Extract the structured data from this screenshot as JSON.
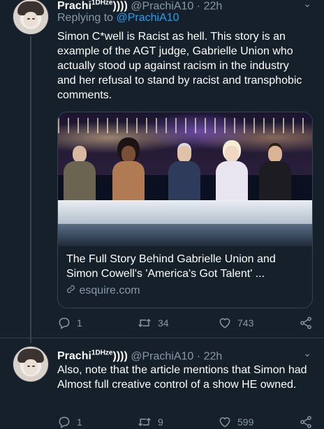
{
  "tweet1": {
    "name": "Prachi",
    "name_sup": "1DHze",
    "name_suffix": "))))",
    "handle": "@PrachiA10",
    "time": "22h",
    "replying_label": "Replying to",
    "replying_handle": "@PrachiA10",
    "text": "Simon C*well is Racist as hell. This story is an example of the AGT judge, Gabrielle Union who actually stood up against racism in the industry and her refusal to stand by racist and transphobic comments.",
    "card": {
      "title": "The Full Story Behind Gabrielle Union and Simon Cowell's 'America's Got Talent' ...",
      "domain": "esquire.com"
    },
    "actions": {
      "replies": "1",
      "retweets": "34",
      "likes": "743"
    }
  },
  "tweet2": {
    "name": "Prachi",
    "name_sup": "1DHze",
    "name_suffix": "))))",
    "handle": "@PrachiA10",
    "time": "22h",
    "text": "Also, note that the article mentions that Simon had Almost full creative control of a show HE owned.",
    "actions": {
      "replies": "1",
      "retweets": "9",
      "likes": "599"
    }
  },
  "colors": {
    "background": "#15202b",
    "secondary_text": "#8899a6",
    "link": "#1da1f2",
    "border": "#38444d"
  },
  "icons": [
    "reply-icon",
    "retweet-icon",
    "like-icon",
    "share-icon",
    "chevron-down-icon",
    "link-icon"
  ]
}
